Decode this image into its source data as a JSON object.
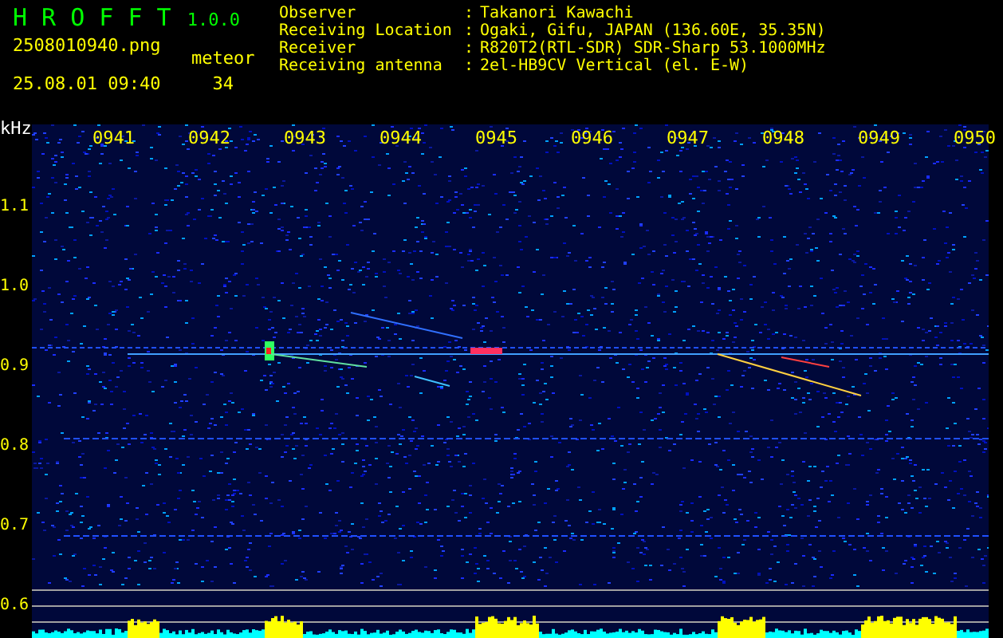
{
  "app": {
    "name": "H R O F F T",
    "version": "1.0.0"
  },
  "file": "2508010940.png",
  "datetime": "25.08.01 09:40",
  "meteor": {
    "label": "meteor",
    "count": "34"
  },
  "info": [
    {
      "label": "Observer",
      "separator": ":",
      "value": "Takanori Kawachi"
    },
    {
      "label": "Receiving Location",
      "separator": ":",
      "value": "Ogaki, Gifu, JAPAN (136.60E, 35.35N)"
    },
    {
      "label": "Receiver",
      "separator": ":",
      "value": "R820T2(RTL-SDR) SDR-Sharp 53.1000MHz"
    },
    {
      "label": "Receiving antenna",
      "separator": ":",
      "value": "2el-HB9CV Vertical (el. E-W)"
    }
  ],
  "spectrogram": {
    "unit": "kHz",
    "time_labels": [
      "0941",
      "0942",
      "0943",
      "0944",
      "0945",
      "0946",
      "0947",
      "0948",
      "0949",
      "0950"
    ],
    "freq_labels": [
      "1.1",
      "1.0",
      "0.9",
      "0.8",
      "0.7",
      "0.6"
    ]
  }
}
